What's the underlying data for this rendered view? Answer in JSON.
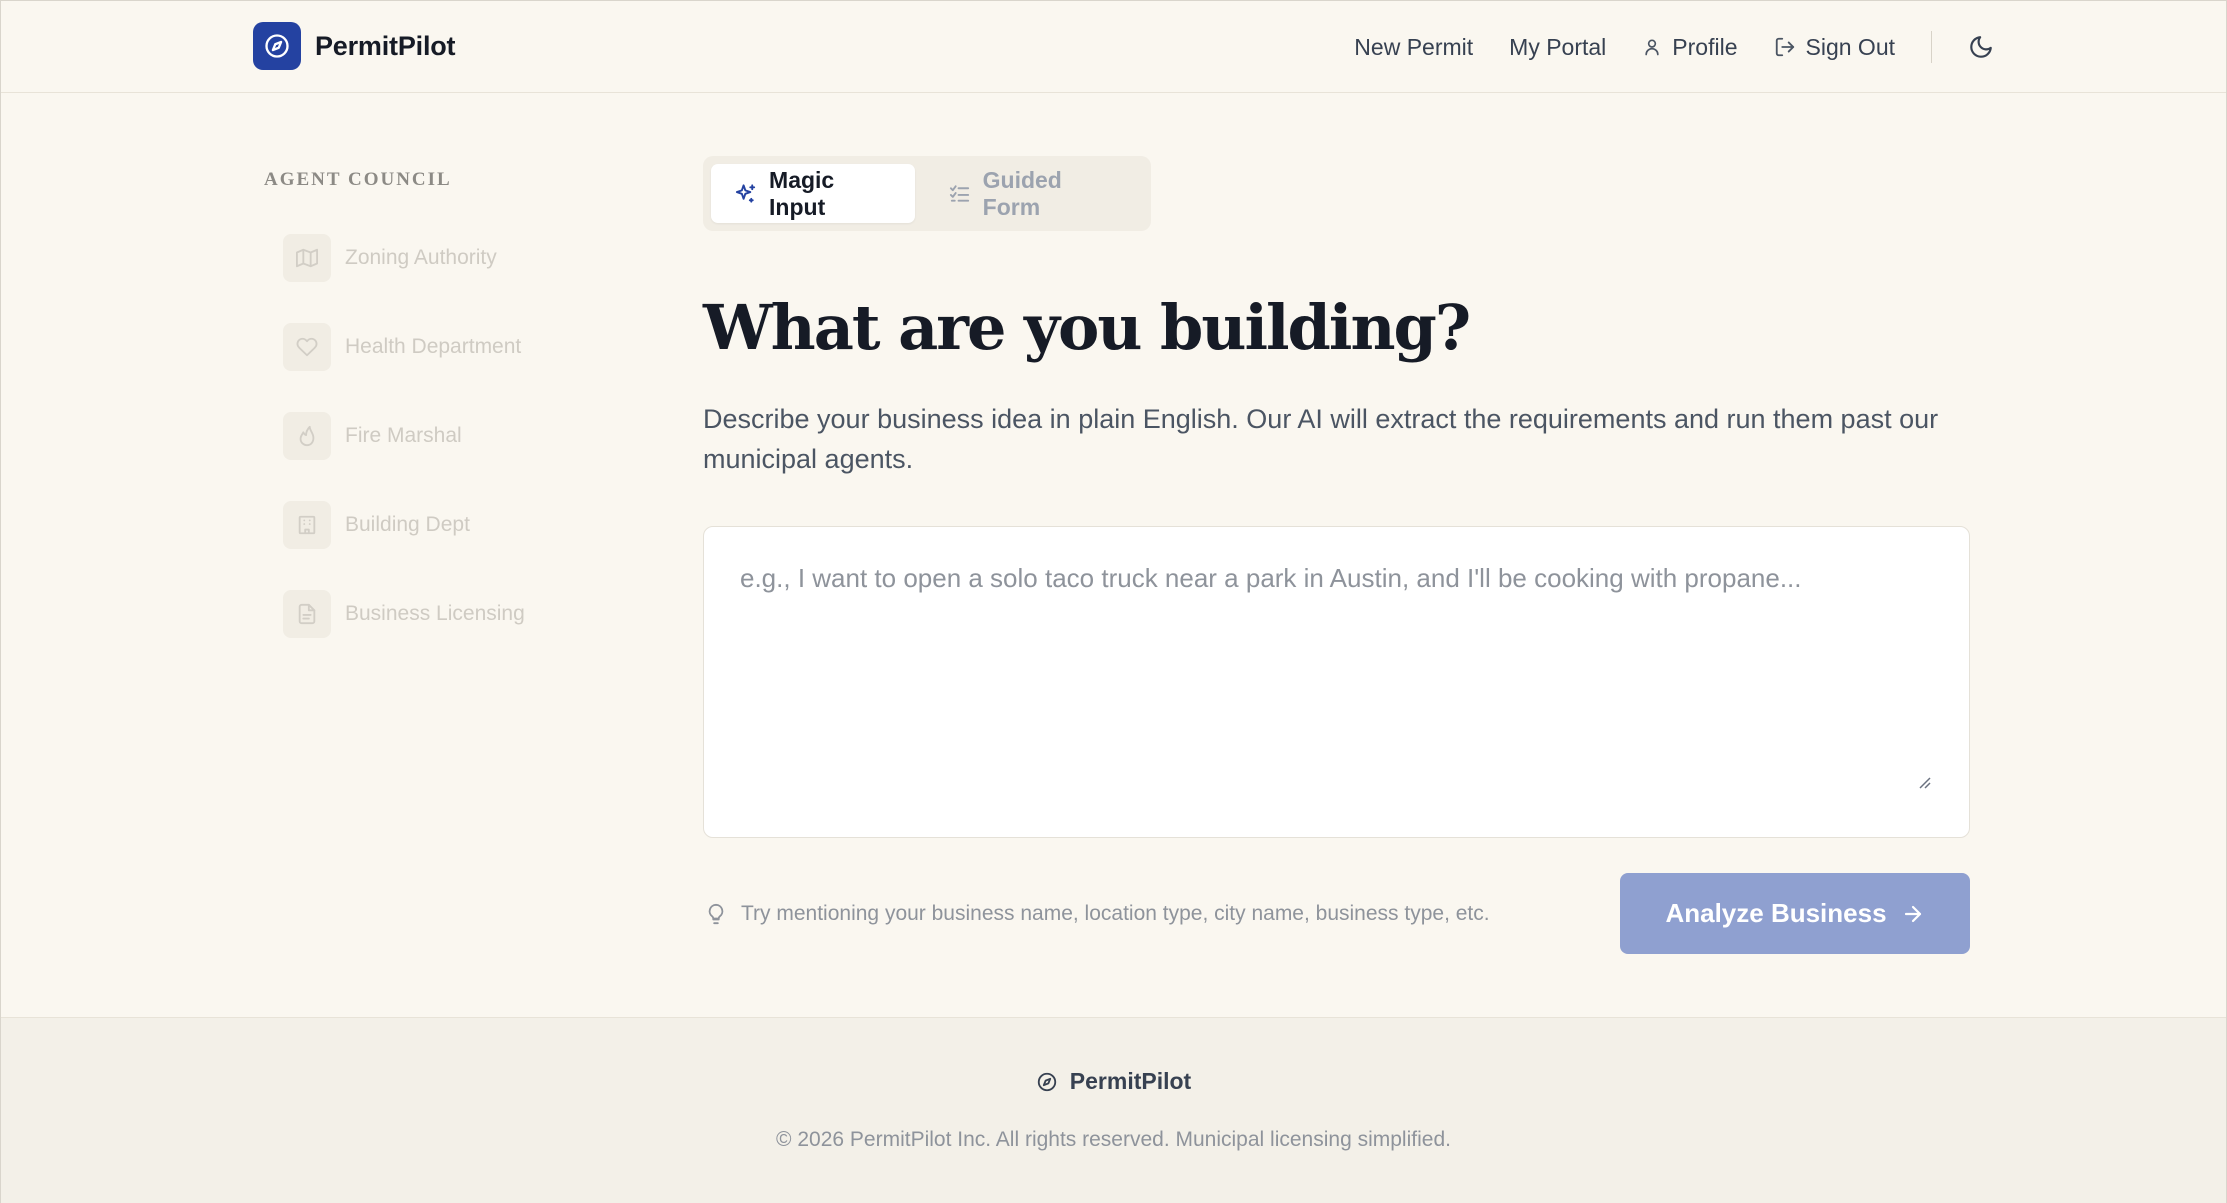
{
  "header": {
    "brand_name": "PermitPilot",
    "nav": {
      "new_permit": "New Permit",
      "my_portal": "My Portal",
      "profile": "Profile",
      "sign_out": "Sign Out"
    }
  },
  "sidebar": {
    "title": "AGENT COUNCIL",
    "items": [
      {
        "label": "Zoning Authority",
        "icon": "map-icon"
      },
      {
        "label": "Health Department",
        "icon": "heart-icon"
      },
      {
        "label": "Fire Marshal",
        "icon": "flame-icon"
      },
      {
        "label": "Building Dept",
        "icon": "building-icon"
      },
      {
        "label": "Business Licensing",
        "icon": "document-icon"
      }
    ]
  },
  "tabs": {
    "magic_input": "Magic Input",
    "guided_form": "Guided Form"
  },
  "main": {
    "title": "What are you building?",
    "description": "Describe your business idea in plain English. Our AI will extract the requirements and run them past our municipal agents.",
    "textarea_placeholder": "e.g., I want to open a solo taco truck near a park in Austin, and I'll be cooking with propane...",
    "textarea_value": "",
    "hint": "Try mentioning your business name, location type, city name, business type, etc.",
    "cta_label": "Analyze Business"
  },
  "footer": {
    "brand_name": "PermitPilot",
    "copyright": "© 2026 PermitPilot Inc. All rights reserved. Municipal licensing simplified."
  },
  "colors": {
    "brand": "#2442a1",
    "cta": "#8fa0d0",
    "background": "#faf7f0",
    "footer_bg": "#f3f0e8"
  }
}
